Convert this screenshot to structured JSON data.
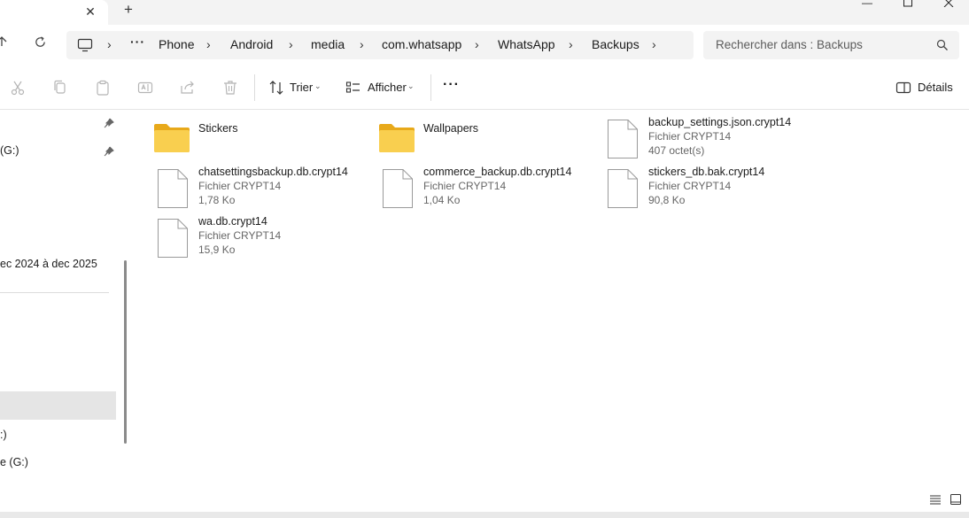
{
  "breadcrumb": {
    "more": "···",
    "items": [
      "Phone",
      "Android",
      "media",
      "com.whatsapp",
      "WhatsApp",
      "Backups"
    ]
  },
  "search": {
    "placeholder": "Rechercher dans : Backups"
  },
  "toolbar": {
    "sort_label": "Trier",
    "view_label": "Afficher",
    "more": "···",
    "details_label": "Détails"
  },
  "sidebar": {
    "item_g1": "(G:)",
    "item_date": "ec 2024 à dec 2025",
    "item_c": ":)",
    "item_g2": "e (G:)"
  },
  "items": [
    {
      "name": "Stickers",
      "kind": "folder",
      "type": "",
      "size": ""
    },
    {
      "name": "Wallpapers",
      "kind": "folder",
      "type": "",
      "size": ""
    },
    {
      "name": "backup_settings.json.crypt14",
      "kind": "file",
      "type": "Fichier CRYPT14",
      "size": "407 octet(s)"
    },
    {
      "name": "chatsettingsbackup.db.crypt14",
      "kind": "file",
      "type": "Fichier CRYPT14",
      "size": "1,78 Ko"
    },
    {
      "name": "commerce_backup.db.crypt14",
      "kind": "file",
      "type": "Fichier CRYPT14",
      "size": "1,04 Ko"
    },
    {
      "name": "stickers_db.bak.crypt14",
      "kind": "file",
      "type": "Fichier CRYPT14",
      "size": "90,8 Ko"
    },
    {
      "name": "wa.db.crypt14",
      "kind": "file",
      "type": "Fichier CRYPT14",
      "size": "15,9 Ko"
    }
  ],
  "colors": {
    "folder": "#f7c33c",
    "folder_back": "#e8a91a",
    "accent": "#0067c0"
  }
}
